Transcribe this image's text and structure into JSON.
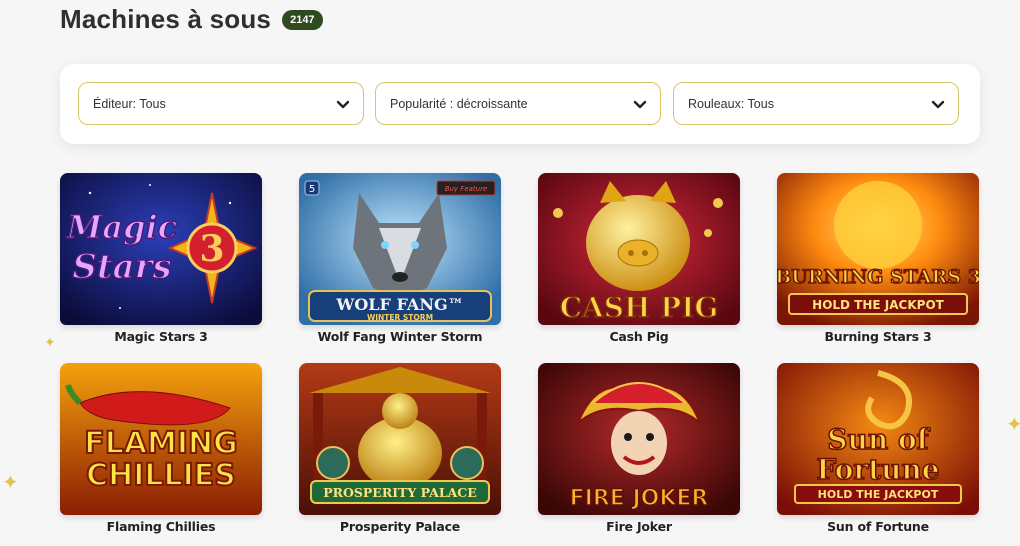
{
  "header": {
    "title": "Machines à sous",
    "count": "2147"
  },
  "filters": [
    {
      "label": "Éditeur: Tous",
      "icon": "chevron-down-icon"
    },
    {
      "label": "Popularité : décroissante",
      "icon": "chevron-down-icon"
    },
    {
      "label": "Rouleaux: Tous",
      "icon": "chevron-down-icon"
    }
  ],
  "games": [
    {
      "name": "Magic Stars 3",
      "art_line1": "Magic",
      "art_line2": "Stars",
      "art_extra": "3"
    },
    {
      "name": "Wolf Fang Winter Storm",
      "art_line1": "WOLF FANG™",
      "art_line2": "WINTER STORM",
      "art_extra": "Buy Feature"
    },
    {
      "name": "Cash Pig",
      "art_line1": "CASH PIG",
      "art_line2": "",
      "art_extra": ""
    },
    {
      "name": "Burning Stars 3",
      "art_line1": "BURNING STARS 3",
      "art_line2": "HOLD THE JACKPOT",
      "art_extra": ""
    },
    {
      "name": "Flaming Chillies",
      "art_line1": "FLAMING",
      "art_line2": "CHILLIES",
      "art_extra": ""
    },
    {
      "name": "Prosperity Palace",
      "art_line1": "PROSPERITY PALACE",
      "art_line2": "",
      "art_extra": ""
    },
    {
      "name": "Fire Joker",
      "art_line1": "FIRE JOKER",
      "art_line2": "",
      "art_extra": ""
    },
    {
      "name": "Sun of Fortune",
      "art_line1": "Sun of",
      "art_line2": "Fortune",
      "art_extra": "HOLD THE JACKPOT"
    }
  ],
  "colors": {
    "badge": "#2f4a1e",
    "select_border": "#d9c56a",
    "accent_gold": "#e5c34a"
  }
}
